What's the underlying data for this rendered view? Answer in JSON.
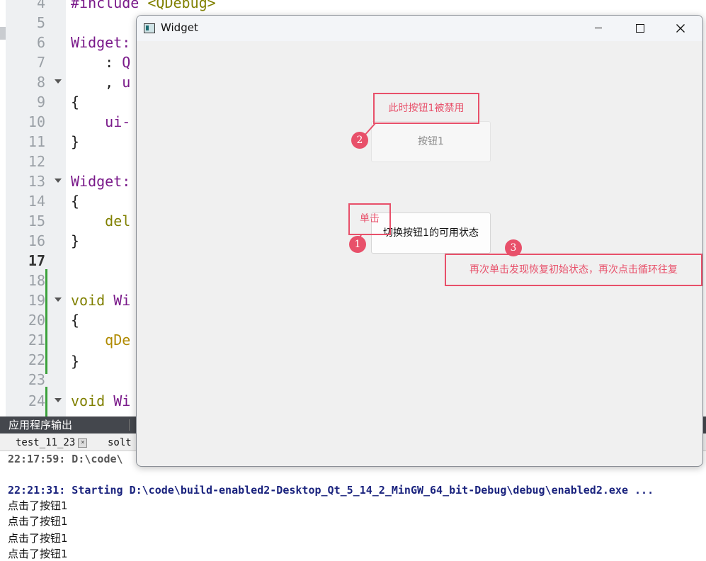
{
  "editor": {
    "line_numbers": [
      "4",
      "5",
      "6",
      "7",
      "8",
      "9",
      "10",
      "11",
      "12",
      "13",
      "14",
      "15",
      "16",
      "17",
      "18",
      "19",
      "20",
      "21",
      "22",
      "23",
      "24"
    ],
    "current_line": "17",
    "code": {
      "l4a": "#include ",
      "l4b": "<QDebug>",
      "l6a": "Widget:",
      "l7a": "    : ",
      "l7b": "Q",
      "l8a": "    , ",
      "l8b": "u",
      "l9": "{",
      "l10": "    ui-",
      "l11": "}",
      "l13a": "Widget:",
      "l14": "{",
      "l15a": "    ",
      "l15b": "del",
      "l16": "}",
      "l19a": "void ",
      "l19b": "Wi",
      "l20": "{",
      "l21a": "    ",
      "l21b": "qDe",
      "l22": "}",
      "l24a": "void ",
      "l24b": "Wi"
    }
  },
  "output_pane": {
    "title": "应用程序输出",
    "tabs": [
      {
        "label": "test_11_23"
      },
      {
        "label": "solt"
      }
    ],
    "lines": {
      "l1": "22:17:59: D:\\code\\",
      "l2": "22:21:31: Starting D:\\code\\build-enabled2-Desktop_Qt_5_14_2_MinGW_64_bit-Debug\\debug\\enabled2.exe ...",
      "l3": "点击了按钮1",
      "l4": "点击了按钮1",
      "l5": "点击了按钮1",
      "l6": "点击了按钮1"
    }
  },
  "window": {
    "title": "Widget",
    "button1_label": "按钮1",
    "button2_label": "切换按钮1的可用状态"
  },
  "annotations": {
    "a1_text": "单击",
    "a1_num": "1",
    "a2_text": "此时按钮1被禁用",
    "a2_num": "2",
    "a3_text": "再次单击发现恢复初始状态，再次点击循环往复",
    "a3_num": "3",
    "color": "#e8506a"
  }
}
